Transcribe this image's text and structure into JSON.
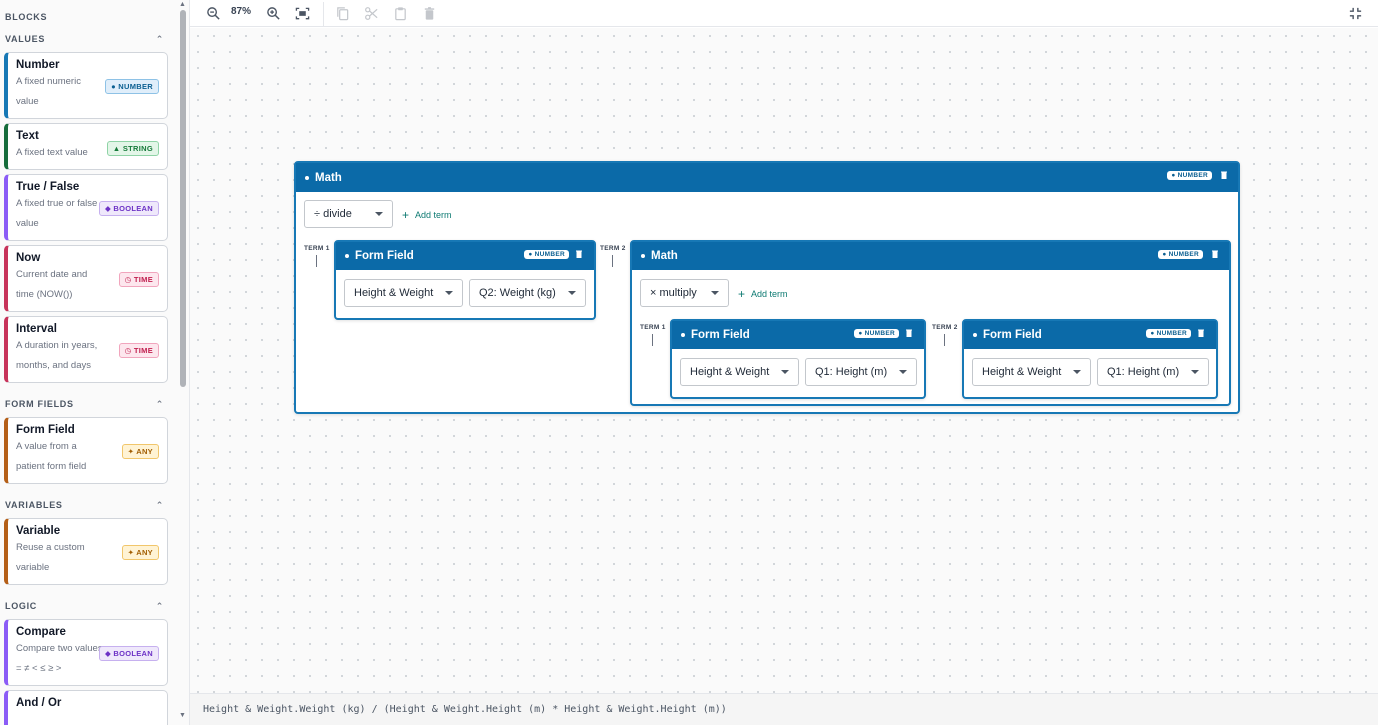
{
  "sidebar": {
    "heading": "BLOCKS",
    "sections": [
      {
        "title": "VALUES",
        "blocks": [
          {
            "title": "Number",
            "desc": "A fixed numeric value",
            "badge": "● NUMBER",
            "type": "number"
          },
          {
            "title": "Text",
            "desc": "A fixed text value",
            "badge": "▲ STRING",
            "type": "string"
          },
          {
            "title": "True / False",
            "desc": "A fixed true or false value",
            "badge": "◆ BOOLEAN",
            "type": "boolean"
          },
          {
            "title": "Now",
            "desc": "Current date and time (NOW())",
            "badge": "◷ TIME",
            "type": "time"
          },
          {
            "title": "Interval",
            "desc": "A duration in years, months, and days",
            "badge": "◷ TIME",
            "type": "time"
          }
        ]
      },
      {
        "title": "FORM FIELDS",
        "blocks": [
          {
            "title": "Form Field",
            "desc": "A value from a patient form field",
            "badge": "✦ ANY",
            "type": "any"
          }
        ]
      },
      {
        "title": "VARIABLES",
        "blocks": [
          {
            "title": "Variable",
            "desc": "Reuse a custom variable",
            "badge": "✦ ANY",
            "type": "any"
          }
        ]
      },
      {
        "title": "LOGIC",
        "blocks": [
          {
            "title": "Compare",
            "desc": "Compare two values = ≠ < ≤ ≥ >",
            "badge": "◆ BOOLEAN",
            "type": "boolean"
          },
          {
            "title": "And / Or",
            "desc": "",
            "badge": "",
            "type": "boolean"
          }
        ]
      }
    ]
  },
  "toolbar": {
    "zoom": "87%"
  },
  "canvas": {
    "root": {
      "title": "Math",
      "badge": "● NUMBER",
      "operator": "÷ divide",
      "add_term": "Add term",
      "term1_label": "TERM 1",
      "term2_label": "TERM 2",
      "term1": {
        "title": "Form Field",
        "badge": "● NUMBER",
        "form": "Height & Weight",
        "field": "Q2: Weight (kg)"
      },
      "term2": {
        "title": "Math",
        "badge": "● NUMBER",
        "operator": "× multiply",
        "add_term": "Add term",
        "term1_label": "TERM 1",
        "term2_label": "TERM 2",
        "term1": {
          "title": "Form Field",
          "badge": "● NUMBER",
          "form": "Height & Weight",
          "field": "Q1: Height (m)"
        },
        "term2": {
          "title": "Form Field",
          "badge": "● NUMBER",
          "form": "Height & Weight",
          "field": "Q1: Height (m)"
        }
      }
    }
  },
  "formula": "Height & Weight.Weight (kg) / (Height & Weight.Height (m) * Height & Weight.Height (m))"
}
